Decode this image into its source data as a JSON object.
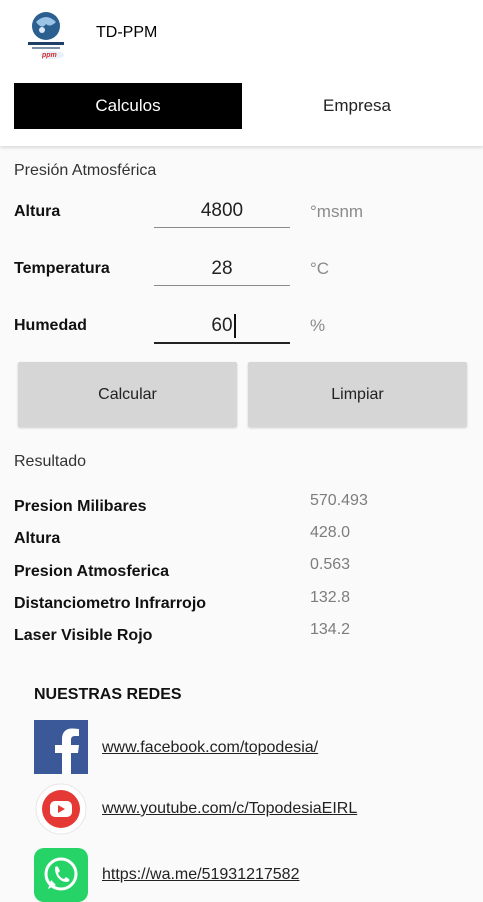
{
  "app": {
    "title": "TD-PPM"
  },
  "tabs": [
    {
      "label": "Calculos",
      "active": true
    },
    {
      "label": "Empresa",
      "active": false
    }
  ],
  "form": {
    "section_title": "Presión Atmosférica",
    "altura": {
      "label": "Altura",
      "value": "4800",
      "unit": "°msnm"
    },
    "temperatura": {
      "label": "Temperatura",
      "value": "28",
      "unit": "°C"
    },
    "humedad": {
      "label": "Humedad",
      "value": "60",
      "unit": "%"
    }
  },
  "buttons": {
    "calcular": "Calcular",
    "limpiar": "Limpiar"
  },
  "results": {
    "title": "Resultado",
    "items": [
      {
        "label": "Presion Milibares",
        "value": "570.493"
      },
      {
        "label": "Altura",
        "value": "428.0"
      },
      {
        "label": "Presion Atmosferica",
        "value": "0.563"
      },
      {
        "label": "Distanciometro Infrarrojo",
        "value": "132.8"
      },
      {
        "label": "Laser Visible Rojo",
        "value": "134.2"
      }
    ]
  },
  "social": {
    "title": "NUESTRAS REDES",
    "links": [
      {
        "icon": "facebook-icon",
        "text": "www.facebook.com/topodesia/"
      },
      {
        "icon": "youtube-icon",
        "text": "www.youtube.com/c/TopodesiaEIRL"
      },
      {
        "icon": "whatsapp-icon",
        "text": "https://wa.me/51931217582"
      }
    ]
  },
  "colors": {
    "tab_active_bg": "#000000",
    "button_bg": "#d6d6d6",
    "facebook": "#3b5998",
    "youtube": "#e53935",
    "whatsapp": "#25d366"
  }
}
